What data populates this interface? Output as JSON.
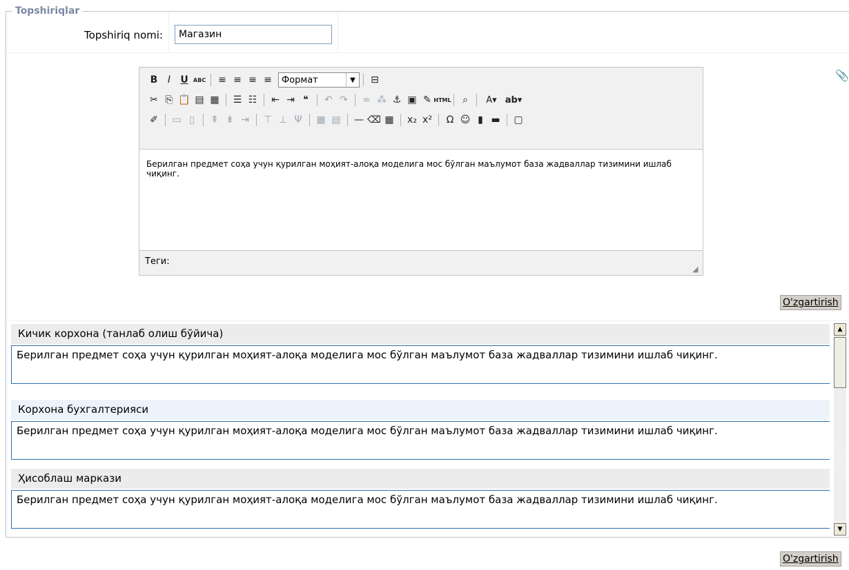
{
  "section": {
    "legend": "Topshiriqlar"
  },
  "form": {
    "name_label": "Topshiriq nomi:",
    "name_value": "Магазин"
  },
  "editor": {
    "format_label": "Формат",
    "content": "Берилган предмет соҳа учун  қурилган моҳият-алоқа моделига  мос бўлган маълумот база жадваллар тизимини  ишлаб чиқинг.",
    "path_label": "Теги:",
    "toolbar_rows": [
      [
        "bold-icon",
        "italic-icon",
        "underline-icon",
        "strikethrough-icon",
        "|",
        "align-left-icon",
        "align-center-icon",
        "align-right-icon",
        "align-justify-icon",
        "FORMAT",
        "|",
        "page-break-icon"
      ],
      [
        "cut-icon",
        "copy-icon",
        "paste-icon",
        "paste-text-icon",
        "paste-word-icon",
        "|",
        "bullet-list-icon",
        "numbered-list-icon",
        "|",
        "outdent-icon",
        "indent-icon",
        "blockquote-icon",
        "|",
        "undo-icon",
        "redo-icon",
        "|",
        "link-icon",
        "unlink-icon",
        "anchor-icon",
        "image-icon",
        "cleanup-icon",
        "html-icon",
        "|",
        "preview-icon",
        "|",
        "text-color-icon",
        "highlight-color-icon"
      ],
      [
        "edit-css-icon",
        "|",
        "table-row-icon",
        "table-col-icon",
        "|",
        "insert-row-before-icon",
        "insert-row-after-icon",
        "delete-row-icon",
        "|",
        "split-cells-icon",
        "merge-cells-icon",
        "delete-col-icon",
        "|",
        "table-icon",
        "table-props-icon",
        "|",
        "horizontal-rule-icon",
        "remove-format-icon",
        "visual-aid-icon",
        "|",
        "subscript-icon",
        "superscript-icon",
        "|",
        "special-char-icon",
        "emoticon-icon",
        "media-icon",
        "advanced-hr-icon",
        "|",
        "fullscreen-icon"
      ]
    ],
    "glyphs": {
      "bold-icon": "B",
      "italic-icon": "I",
      "underline-icon": "U",
      "strikethrough-icon": "ABC",
      "align-left-icon": "≡",
      "align-center-icon": "≡",
      "align-right-icon": "≡",
      "align-justify-icon": "≡",
      "page-break-icon": "⊟",
      "cut-icon": "✂",
      "copy-icon": "⎘",
      "paste-icon": "📋",
      "paste-text-icon": "▤",
      "paste-word-icon": "▦",
      "bullet-list-icon": "☰",
      "numbered-list-icon": "☷",
      "outdent-icon": "⇤",
      "indent-icon": "⇥",
      "blockquote-icon": "❝",
      "undo-icon": "↶",
      "redo-icon": "↷",
      "link-icon": "∞",
      "unlink-icon": "⁂",
      "anchor-icon": "⚓",
      "image-icon": "▣",
      "cleanup-icon": "✎",
      "html-icon": "HTML",
      "preview-icon": "⌕",
      "text-color-icon": "A▾",
      "highlight-color-icon": "ab▾",
      "edit-css-icon": "✐",
      "table-row-icon": "▭",
      "table-col-icon": "▯",
      "insert-row-before-icon": "⇞",
      "insert-row-after-icon": "⇟",
      "delete-row-icon": "⇥",
      "split-cells-icon": "⊤",
      "merge-cells-icon": "⊥",
      "delete-col-icon": "Ψ",
      "table-icon": "▦",
      "table-props-icon": "▤",
      "horizontal-rule-icon": "—",
      "remove-format-icon": "⌫",
      "visual-aid-icon": "▦",
      "subscript-icon": "x₂",
      "superscript-icon": "x²",
      "special-char-icon": "Ω",
      "emoticon-icon": "☺",
      "media-icon": "▮",
      "advanced-hr-icon": "▬",
      "fullscreen-icon": "▢"
    },
    "disabled": [
      "table-row-icon",
      "table-col-icon",
      "insert-row-before-icon",
      "insert-row-after-icon",
      "delete-row-icon",
      "split-cells-icon",
      "merge-cells-icon",
      "delete-col-icon",
      "table-icon",
      "table-props-icon",
      "undo-icon",
      "redo-icon",
      "link-icon",
      "unlink-icon"
    ]
  },
  "buttons": {
    "save_label": "O'zgartirish"
  },
  "items": [
    {
      "title": "Кичик корхона (танлаб олиш бўйича)",
      "body": "Берилган предмет соҳа учун  қурилган моҳият-алоқа моделига  мос бўлган маълумот база жадваллар тизимини  ишлаб чиқинг."
    },
    {
      "title": "Корхона бухгалтерияси",
      "body": "Берилган предмет соҳа учун  қурилган моҳият-алоқа моделига  мос бўлган маълумот база жадваллар тизимини  ишлаб чиқинг."
    },
    {
      "title": "Ҳисоблаш маркази",
      "body": "Берилган предмет соҳа учун  қурилган моҳият-алоқа моделига  мос бўлган маълумот база жадваллар тизимини  ишлаб чиқинг."
    }
  ],
  "colors": {
    "accent": "#2e6faf",
    "legend": "#7a8aa3"
  }
}
